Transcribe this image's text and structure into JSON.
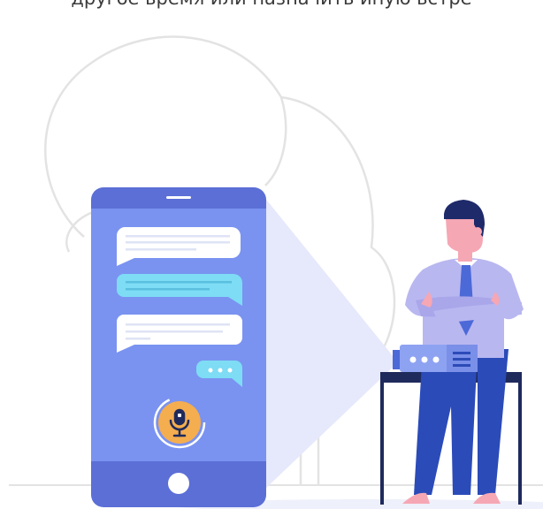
{
  "caption": {
    "text": "другое время или назначить иную встре"
  },
  "colors": {
    "phone_frame": "#5b6fd6",
    "phone_screen": "#7a93f0",
    "bubble_white": "#ffffff",
    "bubble_cyan": "#7edcf4",
    "mic_circle": "#f4ad4f",
    "shirt": "#b9b7f0",
    "tie": "#4c69d8",
    "pants": "#2b4bb8",
    "hair": "#1e2a6a",
    "skin": "#f6a7b4",
    "table": "#1f2a5c",
    "projector": "#8ea2f2",
    "beam": "#e6e8fc",
    "outline": "#e3e3e3"
  },
  "icons": [
    "microphone-icon",
    "typing-dots-icon",
    "home-button-icon",
    "projector-icon"
  ]
}
